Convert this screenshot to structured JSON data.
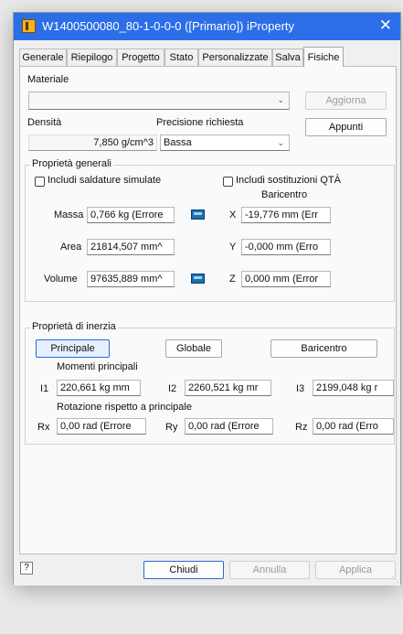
{
  "window": {
    "title": "W1400500080_80-1-0-0-0 ([Primario]) iProperty",
    "close_glyph": "✕"
  },
  "tabs": [
    {
      "label": "Generale"
    },
    {
      "label": "Riepilogo"
    },
    {
      "label": "Progetto"
    },
    {
      "label": "Stato"
    },
    {
      "label": "Personalizzate"
    },
    {
      "label": "Salva"
    },
    {
      "label": "Fisiche",
      "active": true
    }
  ],
  "materiale": {
    "label": "Materiale",
    "value": "",
    "update_button": "Aggiorna"
  },
  "densita": {
    "label": "Densità",
    "value": "7,850 g/cm^3"
  },
  "precisione": {
    "label": "Precisione richiesta",
    "value": "Bassa"
  },
  "appunti_button": "Appunti",
  "general_props": {
    "title": "Proprietà generali",
    "include_welds": "Includi saldature simulate",
    "include_qty": "Includi sostituzioni QTÀ",
    "baricentro_label": "Baricentro",
    "massa": {
      "label": "Massa",
      "value": "0,766 kg (Errore"
    },
    "area": {
      "label": "Area",
      "value": "21814,507 mm^"
    },
    "volume": {
      "label": "Volume",
      "value": "97635,889 mm^"
    },
    "x": {
      "label": "X",
      "value": "-19,776 mm (Err"
    },
    "y": {
      "label": "Y",
      "value": "-0,000 mm (Erro"
    },
    "z": {
      "label": "Z",
      "value": "0,000 mm (Error"
    }
  },
  "inertia": {
    "title": "Proprietà di inerzia",
    "buttons": {
      "principale": "Principale",
      "globale": "Globale",
      "baricentro": "Baricentro"
    },
    "momenti_label": "Momenti principali",
    "i1": {
      "label": "I1",
      "value": "220,661 kg mm"
    },
    "i2": {
      "label": "I2",
      "value": "2260,521 kg mr"
    },
    "i3": {
      "label": "I3",
      "value": "2199,048 kg r"
    },
    "rotazione_label": "Rotazione rispetto a principale",
    "rx": {
      "label": "Rx",
      "value": "0,00 rad (Errore"
    },
    "ry": {
      "label": "Ry",
      "value": "0,00 rad (Errore"
    },
    "rz": {
      "label": "Rz",
      "value": "0,00 rad (Erro"
    }
  },
  "footer": {
    "help": "?",
    "chiudi": "Chiudi",
    "annulla": "Annulla",
    "applica": "Applica"
  },
  "colors": {
    "titlebar": "#2b6ee8",
    "app_icon": "#f2b31d",
    "calc_icon": "#1c6fb0"
  },
  "icons": {
    "app": "iproperty-app-icon",
    "calc": "calculator-icon",
    "help": "help-icon",
    "close": "close-icon"
  }
}
